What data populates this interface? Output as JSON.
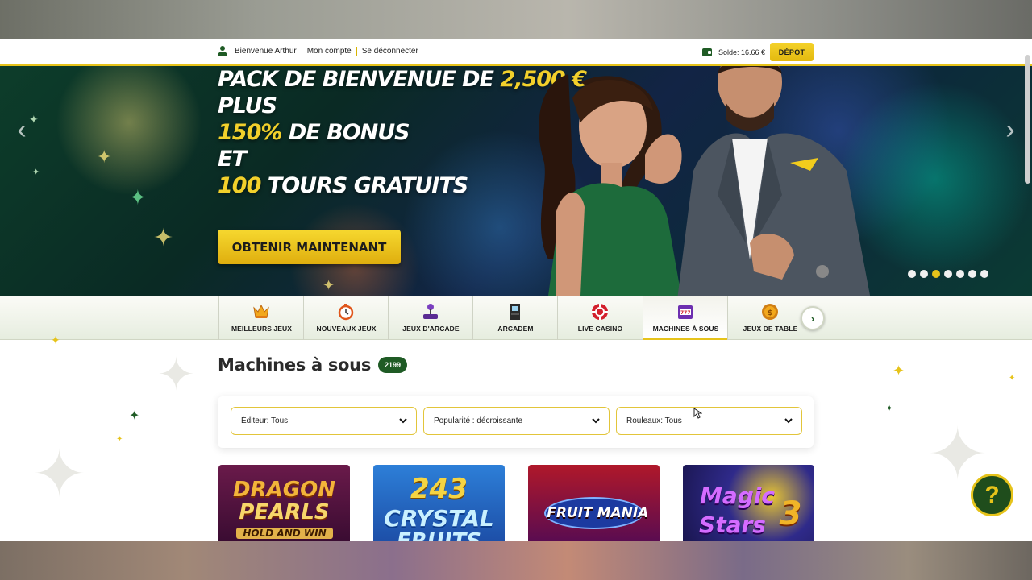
{
  "topbar": {
    "welcome": "Bienvenue Arthur",
    "account": "Mon compte",
    "logout": "Se déconnecter",
    "balance": "Solde: 16.66 €",
    "deposit": "DÉPOT"
  },
  "hero": {
    "line1_a": "PACK DE BIENVENUE DE ",
    "line1_b": "2,500 €",
    "line2": "PLUS",
    "line3_a": "150%",
    "line3_b": " DE BONUS",
    "line4": "ET",
    "line5_a": "100",
    "line5_b": " TOURS GRATUITS",
    "cta": "OBTENIR MAINTENANT",
    "slide_count": 7,
    "active_slide": 3
  },
  "categories": [
    {
      "label": "MEILLEURS JEUX",
      "icon": "crown-icon"
    },
    {
      "label": "NOUVEAUX JEUX",
      "icon": "stopwatch-icon"
    },
    {
      "label": "JEUX D'ARCADE",
      "icon": "joystick-icon"
    },
    {
      "label": "ARCADEM",
      "icon": "arcade-machine-icon"
    },
    {
      "label": "LIVE CASINO",
      "icon": "poker-chip-icon"
    },
    {
      "label": "MACHINES À SOUS",
      "icon": "slot-machine-icon",
      "active": true
    },
    {
      "label": "JEUX DE TABLE",
      "icon": "coin-icon"
    }
  ],
  "section": {
    "title": "Machines à sous",
    "count": "2199"
  },
  "filters": {
    "publisher": "Éditeur: Tous",
    "popularity": "Popularité : décroissante",
    "reels": "Rouleaux: Tous"
  },
  "games": [
    {
      "l1": "DRAGON",
      "l2": "PEARLS",
      "l3": "HOLD AND WIN"
    },
    {
      "l1": "243",
      "l2": "CRYSTAL",
      "l3": "FRUITS"
    },
    {
      "l1": "FRUIT",
      "l2": "MANIA",
      "l3": ""
    },
    {
      "l1": "Magic",
      "l2": "Stars",
      "l3": "3"
    }
  ],
  "help": "?",
  "colors": {
    "brand_green": "#1f5b25",
    "accent_yellow": "#e6c31a"
  }
}
